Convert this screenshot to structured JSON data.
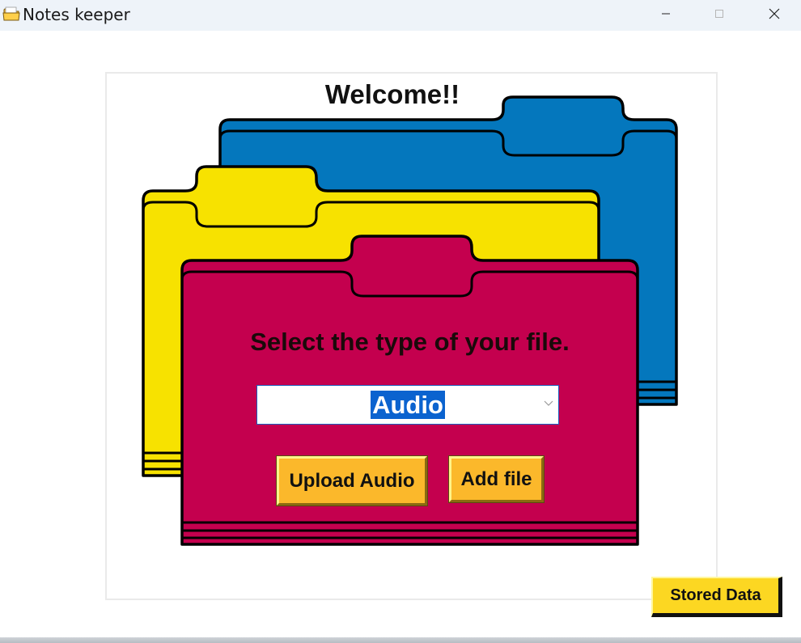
{
  "window": {
    "title": "Notes keeper",
    "icon": "folder-icon",
    "controls": [
      "minimize-icon",
      "maximize-icon",
      "close-icon"
    ]
  },
  "welcome": "Welcome!!",
  "prompt": "Select the type of your file.",
  "file_type_select": {
    "selected": "Audio",
    "icon": "chevron-down-icon"
  },
  "buttons": {
    "upload": "Upload Audio",
    "add_file": "Add file",
    "stored_data": "Stored Data"
  },
  "colors": {
    "folder_blue": "#0477bd",
    "folder_yellow": "#f7e200",
    "folder_crimson": "#c4004e",
    "button_orange": "#fbb82b",
    "button_yellow": "#fcd722",
    "selection_blue": "#0b63cf"
  }
}
